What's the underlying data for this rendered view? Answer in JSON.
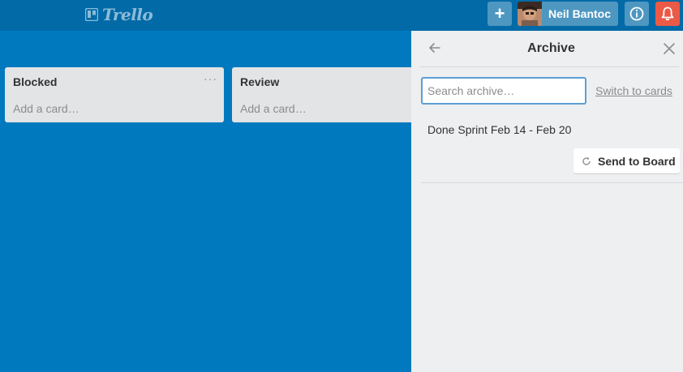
{
  "header": {
    "logo_text": "Trello",
    "add_label": "+",
    "user_name": "Neil Bantoc"
  },
  "lists": [
    {
      "title": "Blocked",
      "menu": "···",
      "add_card": "Add a card…"
    },
    {
      "title": "Review",
      "add_card": "Add a card…"
    }
  ],
  "archive": {
    "title": "Archive",
    "search_placeholder": "Search archive…",
    "switch_label": "Switch to cards",
    "items": [
      {
        "name": "Done Sprint Feb 14 - Feb 20",
        "action": "Send to Board"
      }
    ]
  },
  "colors": {
    "board_bg": "#0079bf",
    "header_bg": "#026aa7",
    "notification": "#eb5a46",
    "sidebar_bg": "#edeff0"
  }
}
